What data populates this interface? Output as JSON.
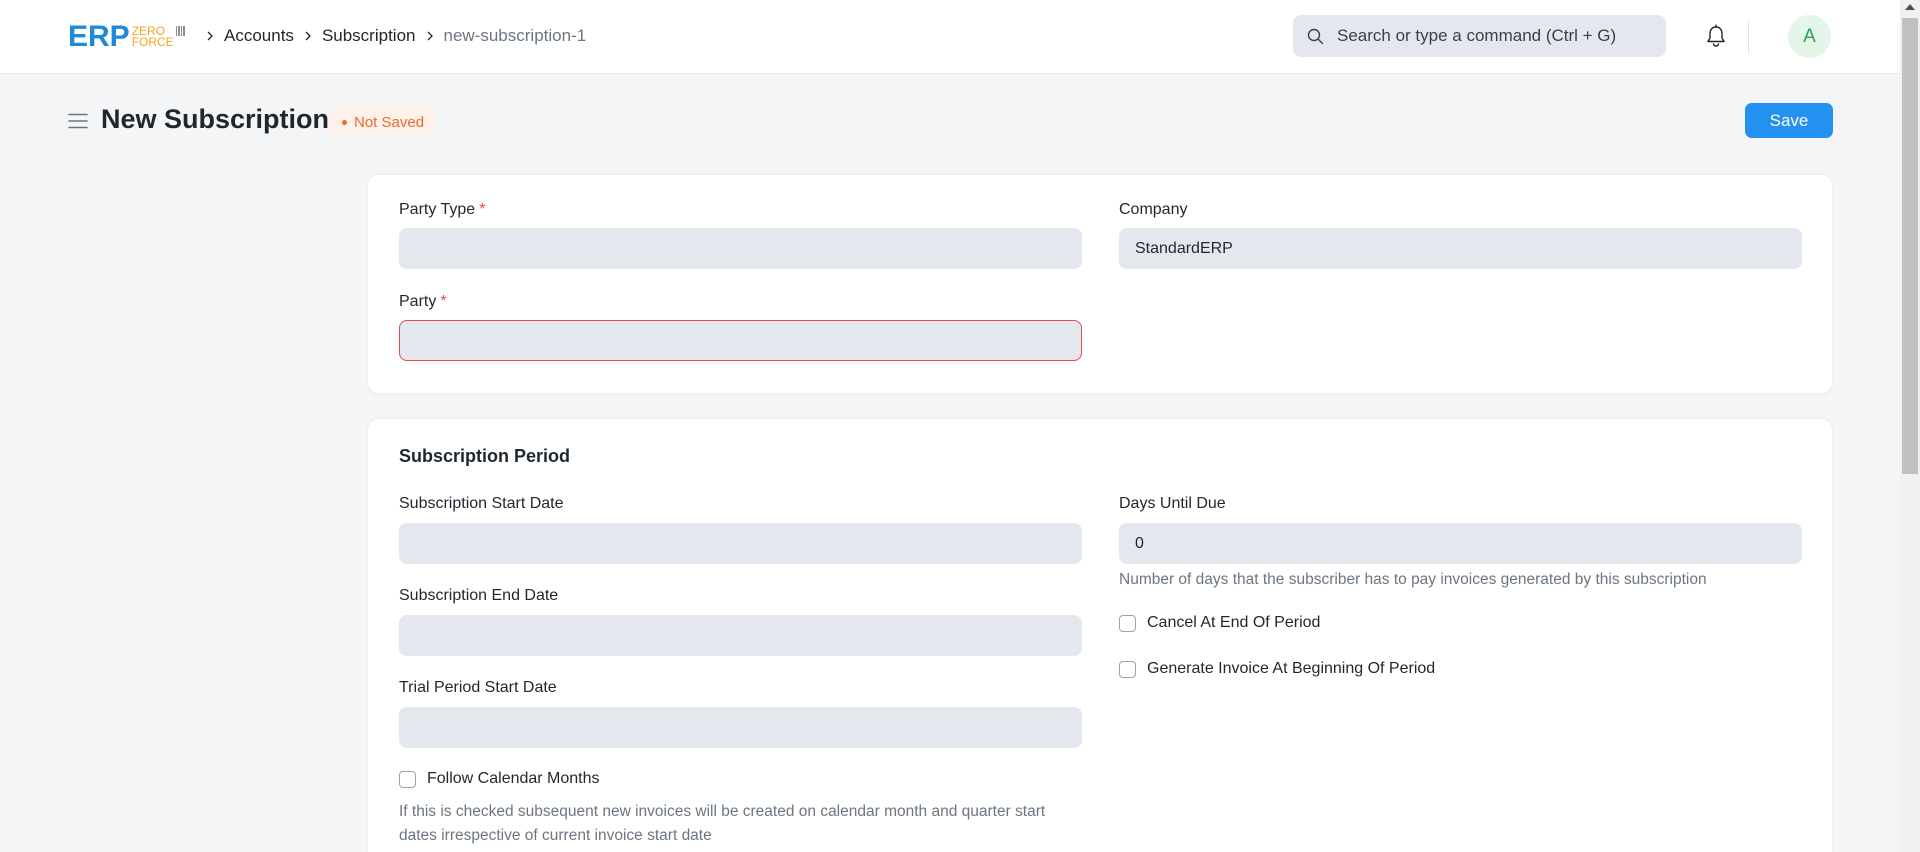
{
  "navbar": {
    "logo": {
      "erp": "ERP",
      "zero": "ZERO",
      "force": "FORCE"
    },
    "breadcrumbs": [
      "Accounts",
      "Subscription",
      "new-subscription-1"
    ],
    "search_placeholder": "Search or type a command (Ctrl + G)",
    "avatar_initial": "A"
  },
  "page": {
    "title": "New Subscription",
    "status": "Not Saved",
    "save_label": "Save"
  },
  "party_section": {
    "party_type_label": "Party Type",
    "party_type_value": "",
    "party_label": "Party",
    "party_value": "",
    "required_mark": "*",
    "company_label": "Company",
    "company_value": "StandardERP"
  },
  "subscription_period": {
    "title": "Subscription Period",
    "start_date_label": "Subscription Start Date",
    "start_date_value": "",
    "end_date_label": "Subscription End Date",
    "end_date_value": "",
    "trial_start_label": "Trial Period Start Date",
    "trial_start_value": "",
    "follow_calendar_label": "Follow Calendar Months",
    "follow_calendar_help_1": "If this is checked subsequent new invoices will be created on calendar month and quarter start",
    "follow_calendar_help_2": "dates irrespective of current invoice start date",
    "days_until_due_label": "Days Until Due",
    "days_until_due_value": "0",
    "days_until_due_help": "Number of days that the subscriber has to pay invoices generated by this subscription",
    "cancel_end_label": "Cancel At End Of Period",
    "generate_invoice_label": "Generate Invoice At Beginning Of Period"
  },
  "colors": {
    "primary": "#2490ef",
    "status": "#e86c2f",
    "required": "#e24c4c",
    "logo_blue": "#1f8ad8",
    "logo_orange": "#f2a71b"
  }
}
